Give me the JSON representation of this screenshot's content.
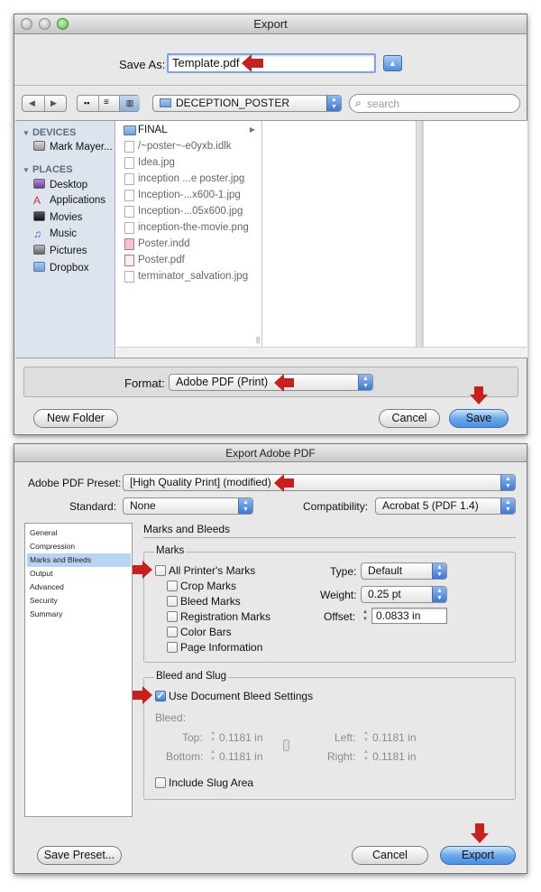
{
  "export_dialog": {
    "title": "Export",
    "save_as_label": "Save As:",
    "save_as_value": "Template.pdf",
    "folder_popup": "DECEPTION_POSTER",
    "search_placeholder": "search",
    "sidebar": {
      "devices_header": "DEVICES",
      "devices": [
        "Mark Mayer..."
      ],
      "places_header": "PLACES",
      "places": [
        "Desktop",
        "Applications",
        "Movies",
        "Music",
        "Pictures",
        "Dropbox"
      ]
    },
    "files": [
      "FINAL",
      "/~poster~-e0yxb.idlk",
      "Idea.jpg",
      "inception ...e poster.jpg",
      "Inception-...x600-1.jpg",
      "Inception-...05x600.jpg",
      "inception-the-movie.png",
      "Poster.indd",
      "Poster.pdf",
      "terminator_salvation.jpg"
    ],
    "format_label": "Format:",
    "format_value": "Adobe PDF (Print)",
    "new_folder_label": "New Folder",
    "cancel_label": "Cancel",
    "save_label": "Save"
  },
  "pdf_dialog": {
    "title": "Export Adobe PDF",
    "preset_label": "Adobe PDF Preset:",
    "preset_value": "[High Quality Print] (modified)",
    "standard_label": "Standard:",
    "standard_value": "None",
    "compat_label": "Compatibility:",
    "compat_value": "Acrobat 5 (PDF 1.4)",
    "categories": [
      "General",
      "Compression",
      "Marks and Bleeds",
      "Output",
      "Advanced",
      "Security",
      "Summary"
    ],
    "selected_category": "Marks and Bleeds",
    "panel_title": "Marks and Bleeds",
    "marks": {
      "group_title": "Marks",
      "all_printers_marks": "All Printer's Marks",
      "crop_marks": "Crop Marks",
      "bleed_marks": "Bleed Marks",
      "registration_marks": "Registration Marks",
      "color_bars": "Color Bars",
      "page_information": "Page Information",
      "type_label": "Type:",
      "type_value": "Default",
      "weight_label": "Weight:",
      "weight_value": "0.25 pt",
      "offset_label": "Offset:",
      "offset_value": "0.0833 in"
    },
    "bleed": {
      "group_title": "Bleed and Slug",
      "use_document_bleed": "Use Document Bleed Settings",
      "bleed_label": "Bleed:",
      "top_label": "Top:",
      "top_value": "0.1181 in",
      "bottom_label": "Bottom:",
      "bottom_value": "0.1181 in",
      "left_label": "Left:",
      "left_value": "0.1181 in",
      "right_label": "Right:",
      "right_value": "0.1181 in",
      "include_slug": "Include Slug Area"
    },
    "save_preset_label": "Save Preset...",
    "cancel_label": "Cancel",
    "export_label": "Export"
  },
  "colors": {
    "annotation_arrow": "#c8201d",
    "selection_blue": "#b9d3f2",
    "sidebar_bg": "#dde4ee"
  }
}
